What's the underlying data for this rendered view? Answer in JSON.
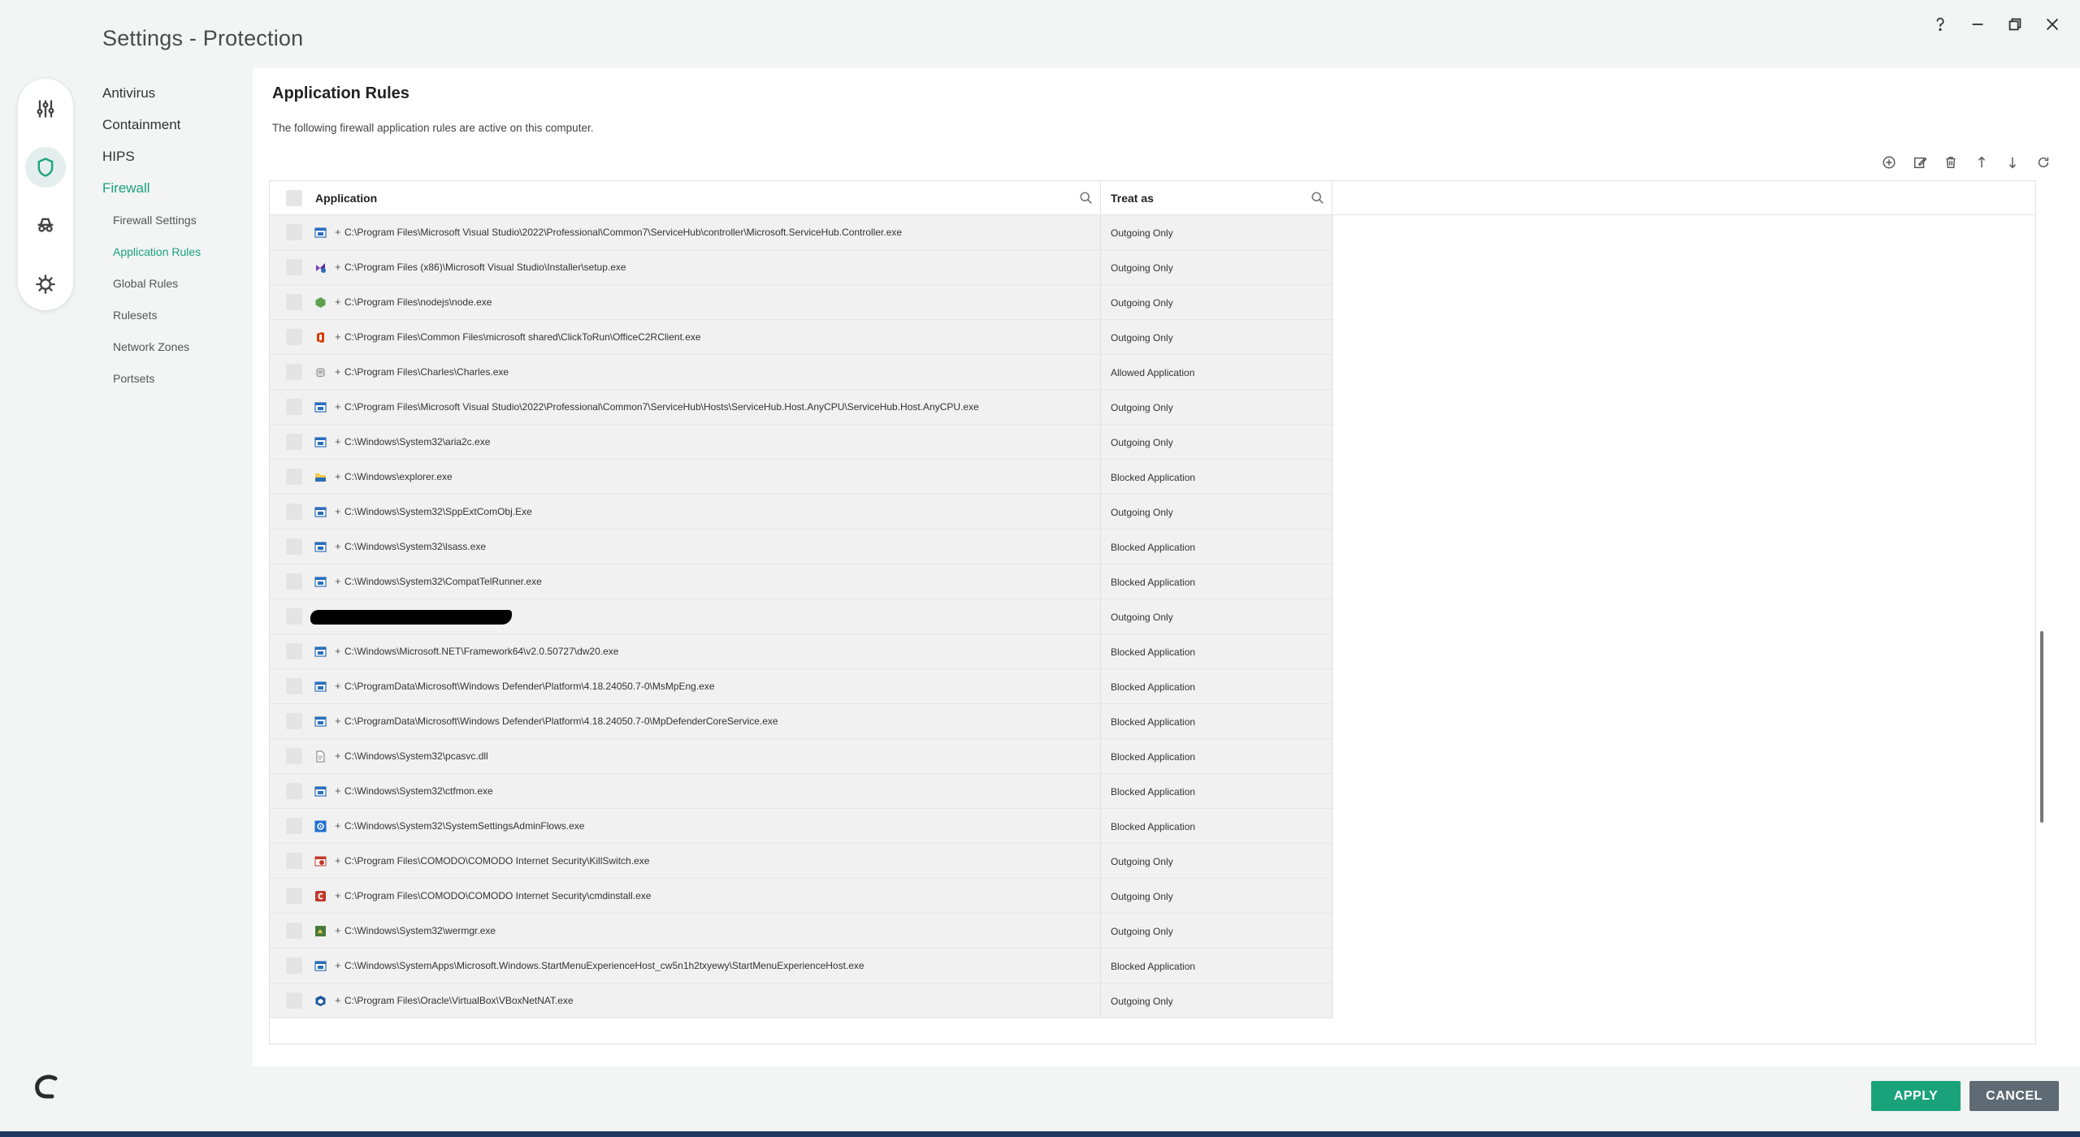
{
  "window": {
    "title": "Settings - Protection"
  },
  "nav": {
    "items": [
      {
        "label": "Antivirus",
        "active": false
      },
      {
        "label": "Containment",
        "active": false
      },
      {
        "label": "HIPS",
        "active": false
      },
      {
        "label": "Firewall",
        "active": true
      }
    ],
    "sub_items": [
      {
        "label": "Firewall Settings",
        "active": false
      },
      {
        "label": "Application Rules",
        "active": true
      },
      {
        "label": "Global Rules",
        "active": false
      },
      {
        "label": "Rulesets",
        "active": false
      },
      {
        "label": "Network Zones",
        "active": false
      },
      {
        "label": "Portsets",
        "active": false
      }
    ]
  },
  "panel": {
    "title": "Application Rules",
    "description": "The following firewall application rules are active on this computer."
  },
  "table": {
    "columns": {
      "application": "Application",
      "treat_as": "Treat as"
    },
    "rows": [
      {
        "icon": "app-window-icon",
        "path": "C:\\Program Files\\Microsoft Visual Studio\\2022\\Professional\\Common7\\ServiceHub\\controller\\Microsoft.ServiceHub.Controller.exe",
        "treat": "Outgoing Only"
      },
      {
        "icon": "visual-studio-installer-icon",
        "path": "C:\\Program Files (x86)\\Microsoft Visual Studio\\Installer\\setup.exe",
        "treat": "Outgoing Only"
      },
      {
        "icon": "nodejs-icon",
        "path": "C:\\Program Files\\nodejs\\node.exe",
        "treat": "Outgoing Only"
      },
      {
        "icon": "office-icon",
        "path": "C:\\Program Files\\Common Files\\microsoft shared\\ClickToRun\\OfficeC2RClient.exe",
        "treat": "Outgoing Only"
      },
      {
        "icon": "charles-icon",
        "path": "C:\\Program Files\\Charles\\Charles.exe",
        "treat": "Allowed Application"
      },
      {
        "icon": "app-window-icon",
        "path": "C:\\Program Files\\Microsoft Visual Studio\\2022\\Professional\\Common7\\ServiceHub\\Hosts\\ServiceHub.Host.AnyCPU\\ServiceHub.Host.AnyCPU.exe",
        "treat": "Outgoing Only"
      },
      {
        "icon": "app-window-icon",
        "path": "C:\\Windows\\System32\\aria2c.exe",
        "treat": "Outgoing Only"
      },
      {
        "icon": "folder-icon",
        "path": "C:\\Windows\\explorer.exe",
        "treat": "Blocked Application"
      },
      {
        "icon": "app-window-icon",
        "path": "C:\\Windows\\System32\\SppExtComObj.Exe",
        "treat": "Outgoing Only"
      },
      {
        "icon": "app-window-icon",
        "path": "C:\\Windows\\System32\\lsass.exe",
        "treat": "Blocked Application"
      },
      {
        "icon": "app-window-icon",
        "path": "C:\\Windows\\System32\\CompatTelRunner.exe",
        "treat": "Blocked Application"
      },
      {
        "icon": "",
        "path": "",
        "treat": "Outgoing Only",
        "redacted": true
      },
      {
        "icon": "app-window-icon",
        "path": "C:\\Windows\\Microsoft.NET\\Framework64\\v2.0.50727\\dw20.exe",
        "treat": "Blocked Application"
      },
      {
        "icon": "app-window-icon",
        "path": "C:\\ProgramData\\Microsoft\\Windows Defender\\Platform\\4.18.24050.7-0\\MsMpEng.exe",
        "treat": "Blocked Application"
      },
      {
        "icon": "app-window-icon",
        "path": "C:\\ProgramData\\Microsoft\\Windows Defender\\Platform\\4.18.24050.7-0\\MpDefenderCoreService.exe",
        "treat": "Blocked Application"
      },
      {
        "icon": "file-icon",
        "path": "C:\\Windows\\System32\\pcasvc.dll",
        "treat": "Blocked Application"
      },
      {
        "icon": "app-window-icon",
        "path": "C:\\Windows\\System32\\ctfmon.exe",
        "treat": "Blocked Application"
      },
      {
        "icon": "settings-gear-icon",
        "path": "C:\\Windows\\System32\\SystemSettingsAdminFlows.exe",
        "treat": "Blocked Application"
      },
      {
        "icon": "comodo-killswitch-icon",
        "path": "C:\\Program Files\\COMODO\\COMODO Internet Security\\KillSwitch.exe",
        "treat": "Outgoing Only"
      },
      {
        "icon": "comodo-icon",
        "path": "C:\\Program Files\\COMODO\\COMODO Internet Security\\cmdinstall.exe",
        "treat": "Outgoing Only"
      },
      {
        "icon": "wermgr-icon",
        "path": "C:\\Windows\\System32\\wermgr.exe",
        "treat": "Outgoing Only"
      },
      {
        "icon": "app-window-icon",
        "path": "C:\\Windows\\SystemApps\\Microsoft.Windows.StartMenuExperienceHost_cw5n1h2txyewy\\StartMenuExperienceHost.exe",
        "treat": "Blocked Application"
      },
      {
        "icon": "virtualbox-icon",
        "path": "C:\\Program Files\\Oracle\\VirtualBox\\VBoxNetNAT.exe",
        "treat": "Outgoing Only"
      }
    ]
  },
  "buttons": {
    "apply": "APPLY",
    "cancel": "CANCEL"
  },
  "colors": {
    "accent": "#1aa37a",
    "cancel": "#5e6a74"
  }
}
